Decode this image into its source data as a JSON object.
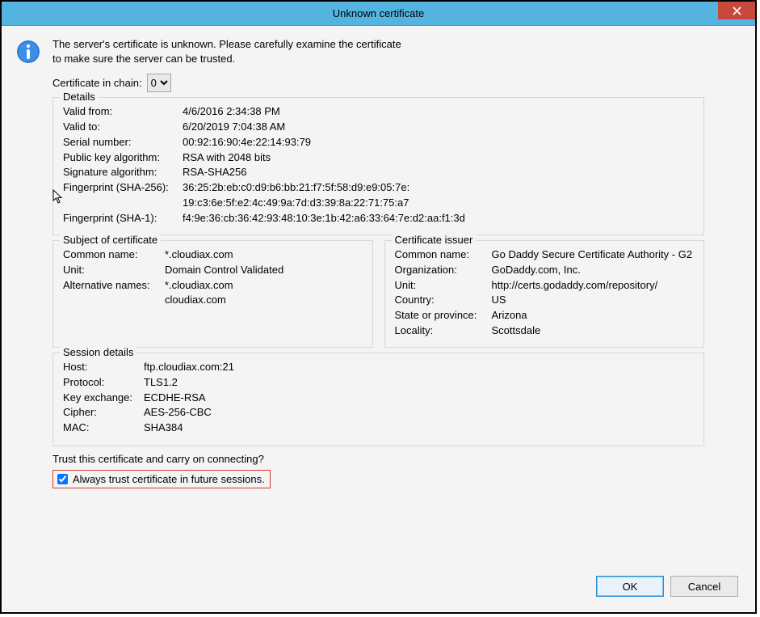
{
  "window": {
    "title": "Unknown certificate"
  },
  "intro": {
    "line1": "The server's certificate is unknown. Please carefully examine the certificate",
    "line2": "to make sure the server can be trusted."
  },
  "chain": {
    "label": "Certificate in chain:",
    "value": "0"
  },
  "details": {
    "legend": "Details",
    "valid_from": {
      "k": "Valid from:",
      "v": "4/6/2016 2:34:38 PM"
    },
    "valid_to": {
      "k": "Valid to:",
      "v": "6/20/2019 7:04:38 AM"
    },
    "serial": {
      "k": "Serial number:",
      "v": "00:92:16:90:4e:22:14:93:79"
    },
    "pubkey": {
      "k": "Public key algorithm:",
      "v": "RSA with 2048 bits"
    },
    "sig": {
      "k": "Signature algorithm:",
      "v": "RSA-SHA256"
    },
    "fp256": {
      "k": "Fingerprint (SHA-256):",
      "v": "36:25:2b:eb:c0:d9:b6:bb:21:f7:5f:58:d9:e9:05:7e:\n19:c3:6e:5f:e2:4c:49:9a:7d:d3:39:8a:22:71:75:a7"
    },
    "fp1": {
      "k": "Fingerprint (SHA-1):",
      "v": "f4:9e:36:cb:36:42:93:48:10:3e:1b:42:a6:33:64:7e:d2:aa:f1:3d"
    }
  },
  "subject": {
    "legend": "Subject of certificate",
    "cn": {
      "k": "Common name:",
      "v": "*.cloudiax.com"
    },
    "unit": {
      "k": "Unit:",
      "v": "Domain Control Validated"
    },
    "alt": {
      "k": "Alternative names:",
      "v": "*.cloudiax.com\ncloudiax.com"
    }
  },
  "issuer": {
    "legend": "Certificate issuer",
    "cn": {
      "k": "Common name:",
      "v": "Go Daddy Secure Certificate Authority - G2"
    },
    "org": {
      "k": "Organization:",
      "v": "GoDaddy.com, Inc."
    },
    "unit": {
      "k": "Unit:",
      "v": "http://certs.godaddy.com/repository/"
    },
    "ctry": {
      "k": "Country:",
      "v": "US"
    },
    "prov": {
      "k": "State or province:",
      "v": "Arizona"
    },
    "loc": {
      "k": "Locality:",
      "v": "Scottsdale"
    }
  },
  "session": {
    "legend": "Session details",
    "host": {
      "k": "Host:",
      "v": "ftp.cloudiax.com:21"
    },
    "prot": {
      "k": "Protocol:",
      "v": "TLS1.2"
    },
    "kex": {
      "k": "Key exchange:",
      "v": "ECDHE-RSA"
    },
    "ciph": {
      "k": "Cipher:",
      "v": "AES-256-CBC"
    },
    "mac": {
      "k": "MAC:",
      "v": "SHA384"
    }
  },
  "trust": {
    "question": "Trust this certificate and carry on connecting?",
    "always": "Always trust certificate in future sessions.",
    "always_checked": true
  },
  "buttons": {
    "ok": "OK",
    "cancel": "Cancel"
  }
}
